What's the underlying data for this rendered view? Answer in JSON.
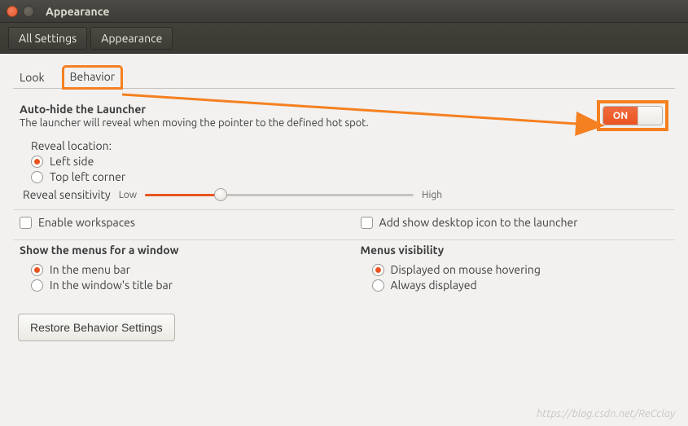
{
  "window": {
    "title": "Appearance"
  },
  "breadcrumb": {
    "all_settings": "All Settings",
    "current": "Appearance"
  },
  "tabs": {
    "look": "Look",
    "behavior": "Behavior"
  },
  "autohide": {
    "heading": "Auto-hide the Launcher",
    "desc": "The launcher will reveal when moving the pointer to the defined hot spot.",
    "switch_label": "ON",
    "reveal_location_label": "Reveal location:",
    "options": {
      "left_side": "Left side",
      "top_left": "Top left corner"
    },
    "sensitivity_label": "Reveal sensitivity",
    "sensitivity_low": "Low",
    "sensitivity_high": "High"
  },
  "workspaces": {
    "enable": "Enable workspaces",
    "add_desktop_icon": "Add show desktop icon to the launcher"
  },
  "menus": {
    "show_heading": "Show the menus for a window",
    "in_menu_bar": "In the menu bar",
    "in_title_bar": "In the window's title bar",
    "visibility_heading": "Menus visibility",
    "on_hover": "Displayed on mouse hovering",
    "always": "Always displayed"
  },
  "restore_button": "Restore Behavior Settings",
  "watermark": "https://blog.csdn.net/ReCclay"
}
